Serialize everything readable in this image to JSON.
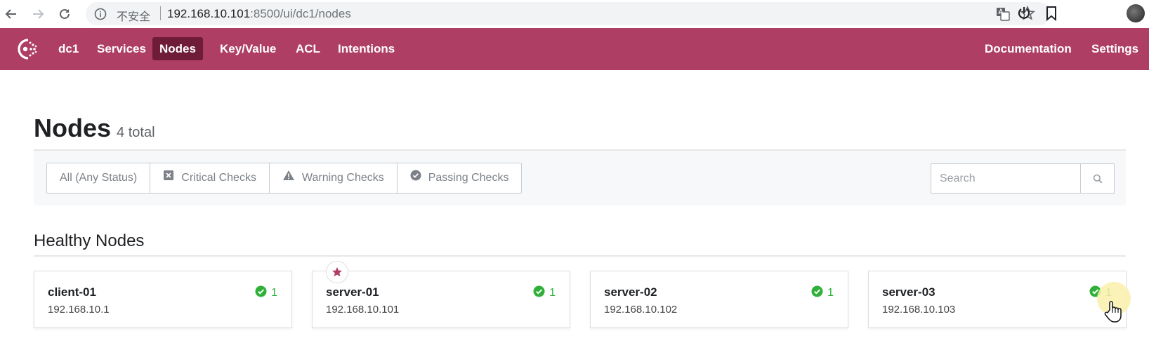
{
  "browser": {
    "insecure_label": "不安全",
    "url_host": "192.168.10.101",
    "url_rest": ":8500/ui/dc1/nodes"
  },
  "header": {
    "datacenter": "dc1",
    "nav": [
      {
        "label": "Services"
      },
      {
        "label": "Nodes"
      },
      {
        "label": "Key/Value"
      },
      {
        "label": "ACL"
      },
      {
        "label": "Intentions"
      }
    ],
    "documentation": "Documentation",
    "settings": "Settings",
    "active_color": "#6e1c38",
    "brand_color": "#ae3e63"
  },
  "page": {
    "title": "Nodes",
    "count": "4 total"
  },
  "filters": {
    "all": "All (Any Status)",
    "critical": "Critical Checks",
    "warning": "Warning Checks",
    "passing": "Passing Checks",
    "search_placeholder": "Search"
  },
  "section": {
    "title": "Healthy Nodes"
  },
  "nodes": [
    {
      "name": "client-01",
      "address": "192.168.10.1",
      "checks": "1",
      "leader": false
    },
    {
      "name": "server-01",
      "address": "192.168.10.101",
      "checks": "1",
      "leader": true
    },
    {
      "name": "server-02",
      "address": "192.168.10.102",
      "checks": "1",
      "leader": false
    },
    {
      "name": "server-03",
      "address": "192.168.10.103",
      "checks": "1",
      "leader": false
    }
  ],
  "status_color": "#2eb039"
}
